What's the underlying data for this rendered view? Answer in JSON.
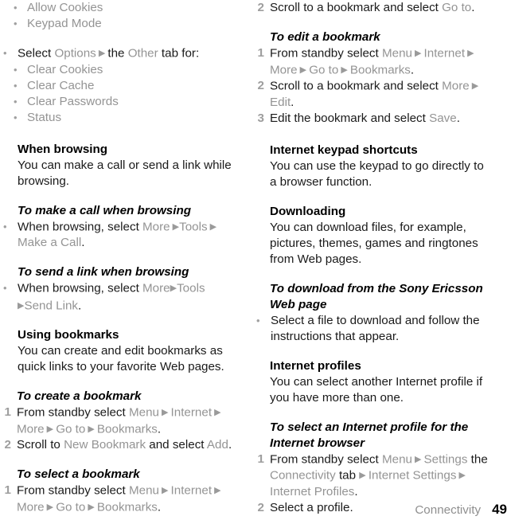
{
  "document": {
    "footer": {
      "chapter": "Connectivity",
      "page_number": "49"
    },
    "arrow_glyph": "▶",
    "bullet_glyph": "•",
    "colors": {
      "body_text": "#1a1a1a",
      "ui_reference_text": "#949494",
      "bullet": "#a0a0a0",
      "step_number": "#9e9e9e",
      "background": "#ffffff"
    }
  },
  "left_column": {
    "continued_sub_bullets": [
      {
        "label": "Allow Cookies"
      },
      {
        "label": "Keypad Mode"
      }
    ],
    "options_bullet": {
      "t1": "Select ",
      "ui1": "Options",
      "t2": " the ",
      "ui2": "Other",
      "t3": " tab for:",
      "sub_items": [
        {
          "label": "Clear Cookies"
        },
        {
          "label": "Clear Cache"
        },
        {
          "label": "Clear Passwords"
        },
        {
          "label": "Status"
        }
      ]
    },
    "when_browsing": {
      "heading": "When browsing",
      "body": "You can make a call or send a link while browsing."
    },
    "make_call_proc": {
      "heading": "To make a call when browsing",
      "t1": "When browsing, select ",
      "ui1": "More",
      "ui2": "Tools",
      "ui3": "Make a Call",
      "t_end": "."
    },
    "send_link_proc": {
      "heading": "To send a link when browsing",
      "t1": "When browsing, select ",
      "ui1": "More",
      "ui2": "Tools",
      "ui3": "Send Link",
      "t_end": "."
    },
    "using_bookmarks": {
      "heading": "Using bookmarks",
      "body": "You can create and edit bookmarks as quick links to your favorite Web pages."
    },
    "create_bookmark_proc": {
      "heading": "To create a bookmark",
      "steps": [
        {
          "number": "1",
          "t1": "From standby select ",
          "ui1": "Menu",
          "ui2": "Internet",
          "ui3": "More",
          "ui4": "Go to",
          "ui5": "Bookmarks",
          "t_end": "."
        },
        {
          "number": "2",
          "t1": "Scroll to ",
          "ui1": "New Bookmark",
          "t2": " and select ",
          "ui2": "Add",
          "t_end": "."
        }
      ]
    },
    "select_bookmark_proc": {
      "heading": "To select a bookmark",
      "steps": [
        {
          "number": "1",
          "t1": "From standby select ",
          "ui1": "Menu",
          "ui2": "Internet",
          "ui3": "More",
          "ui4": "Go to",
          "ui5": "Bookmarks",
          "t_end": "."
        }
      ]
    }
  },
  "right_column": {
    "select_bookmark_continued": {
      "number": "2",
      "t1": "Scroll to a bookmark and select ",
      "ui1": "Go to",
      "t_end": "."
    },
    "edit_bookmark_proc": {
      "heading": "To edit a bookmark",
      "steps": [
        {
          "number": "1",
          "t1": "From standby select ",
          "ui1": "Menu",
          "ui2": "Internet",
          "ui3": "More",
          "ui4": "Go to",
          "ui5": "Bookmarks",
          "t_end": "."
        },
        {
          "number": "2",
          "t1": "Scroll to a bookmark and select ",
          "ui1": "More",
          "ui2": "Edit",
          "t_end": "."
        },
        {
          "number": "3",
          "t1": "Edit the bookmark and select ",
          "ui1": "Save",
          "t_end": "."
        }
      ]
    },
    "keypad_shortcuts": {
      "heading": "Internet keypad shortcuts",
      "body": "You can use the keypad to go directly to a browser function."
    },
    "downloading": {
      "heading": "Downloading",
      "body": "You can download files, for example, pictures, themes, games and ringtones from Web pages."
    },
    "download_proc": {
      "heading": "To download from the Sony Ericsson Web page",
      "bullet": "Select a file to download and follow the instructions that appear."
    },
    "internet_profiles": {
      "heading": "Internet profiles",
      "body": "You can select another Internet profile if you have more than one."
    },
    "select_profile_proc": {
      "heading": "To select an Internet profile for the Internet browser",
      "steps": [
        {
          "number": "1",
          "t1": "From standby select ",
          "ui1": "Menu",
          "ui2": "Settings",
          "t2": " the ",
          "ui3": "Connectivity",
          "t3": " tab ",
          "ui4": "Internet Settings",
          "ui5": "Internet Profiles",
          "t_end": "."
        },
        {
          "number": "2",
          "t1": "Select a profile.",
          "t_end": ""
        }
      ]
    }
  }
}
